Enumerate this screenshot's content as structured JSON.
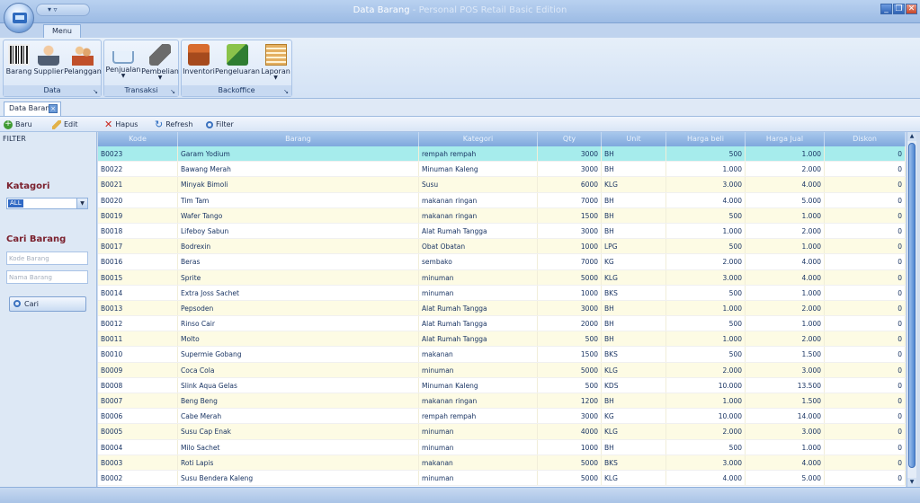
{
  "window": {
    "title_main": "Data Barang",
    "title_sep": " - ",
    "title_app": "Personal POS Retail Basic Edition"
  },
  "ribbon": {
    "tab": "Menu",
    "groups": [
      {
        "label": "Data",
        "buttons": [
          "Barang",
          "Supplier",
          "Pelanggan"
        ]
      },
      {
        "label": "Transaksi",
        "buttons": [
          "Penjualan",
          "Pembelian"
        ]
      },
      {
        "label": "Backoffice",
        "buttons": [
          "Inventori",
          "Pengeluaran",
          "Laporan"
        ]
      }
    ]
  },
  "doc_tab": "Data Barang",
  "toolbar": {
    "baru": "Baru",
    "edit": "Edit",
    "hapus": "Hapus",
    "refresh": "Refresh",
    "filter": "Filter"
  },
  "filter_panel": {
    "title": "FILTER",
    "kategori_label": "Katagori",
    "kategori_value": "ALL",
    "cari_label": "Cari Barang",
    "kode_placeholder": "Kode Barang",
    "nama_placeholder": "Nama Barang",
    "cari_button": "Cari"
  },
  "grid": {
    "columns": [
      "Kode",
      "Barang",
      "Kategori",
      "Qty",
      "Unit",
      "Harga beli",
      "Harga Jual",
      "Diskon"
    ],
    "rows": [
      [
        "B0023",
        "Garam Yodium",
        "rempah rempah",
        "3000",
        "BH",
        "500",
        "1.000",
        "0"
      ],
      [
        "B0022",
        "Bawang Merah",
        "Minuman Kaleng",
        "3000",
        "BH",
        "1.000",
        "2.000",
        "0"
      ],
      [
        "B0021",
        "Minyak Bimoli",
        "Susu",
        "6000",
        "KLG",
        "3.000",
        "4.000",
        "0"
      ],
      [
        "B0020",
        "Tim Tam",
        "makanan ringan",
        "7000",
        "BH",
        "4.000",
        "5.000",
        "0"
      ],
      [
        "B0019",
        "Wafer Tango",
        "makanan ringan",
        "1500",
        "BH",
        "500",
        "1.000",
        "0"
      ],
      [
        "B0018",
        "Lifeboy Sabun",
        "Alat Rumah Tangga",
        "3000",
        "BH",
        "1.000",
        "2.000",
        "0"
      ],
      [
        "B0017",
        "Bodrexin",
        "Obat Obatan",
        "1000",
        "LPG",
        "500",
        "1.000",
        "0"
      ],
      [
        "B0016",
        "Beras",
        "sembako",
        "7000",
        "KG",
        "2.000",
        "4.000",
        "0"
      ],
      [
        "B0015",
        "Sprite",
        "minuman",
        "5000",
        "KLG",
        "3.000",
        "4.000",
        "0"
      ],
      [
        "B0014",
        "Extra Joss Sachet",
        "minuman",
        "1000",
        "BKS",
        "500",
        "1.000",
        "0"
      ],
      [
        "B0013",
        "Pepsoden",
        "Alat Rumah Tangga",
        "3000",
        "BH",
        "1.000",
        "2.000",
        "0"
      ],
      [
        "B0012",
        "Rinso Cair",
        "Alat Rumah Tangga",
        "2000",
        "BH",
        "500",
        "1.000",
        "0"
      ],
      [
        "B0011",
        "Molto",
        "Alat Rumah Tangga",
        "500",
        "BH",
        "1.000",
        "2.000",
        "0"
      ],
      [
        "B0010",
        "Supermie Gobang",
        "makanan",
        "1500",
        "BKS",
        "500",
        "1.500",
        "0"
      ],
      [
        "B0009",
        "Coca Cola",
        "minuman",
        "5000",
        "KLG",
        "2.000",
        "3.000",
        "0"
      ],
      [
        "B0008",
        "Slink Aqua Gelas",
        "Minuman Kaleng",
        "500",
        "KDS",
        "10.000",
        "13.500",
        "0"
      ],
      [
        "B0007",
        "Beng Beng",
        "makanan ringan",
        "1200",
        "BH",
        "1.000",
        "1.500",
        "0"
      ],
      [
        "B0006",
        "Cabe Merah",
        "rempah rempah",
        "3000",
        "KG",
        "10.000",
        "14.000",
        "0"
      ],
      [
        "B0005",
        "Susu Cap Enak",
        "minuman",
        "4000",
        "KLG",
        "2.000",
        "3.000",
        "0"
      ],
      [
        "B0004",
        "Milo Sachet",
        "minuman",
        "1000",
        "BH",
        "500",
        "1.000",
        "0"
      ],
      [
        "B0003",
        "Roti Lapis",
        "makanan",
        "5000",
        "BKS",
        "3.000",
        "4.000",
        "0"
      ],
      [
        "B0002",
        "Susu Bendera Kaleng",
        "minuman",
        "5000",
        "KLG",
        "4.000",
        "5.000",
        "0"
      ]
    ]
  }
}
